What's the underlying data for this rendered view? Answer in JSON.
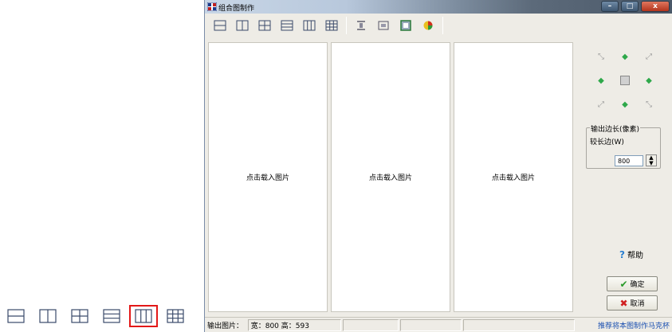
{
  "window": {
    "title": "组合图制作",
    "controls": {
      "minimize": "–",
      "maximize": "□",
      "close": "x"
    }
  },
  "left_toolbar": {
    "buttons": [
      {
        "icon": "layout-2-rows-icon"
      },
      {
        "icon": "layout-2-cols-icon"
      },
      {
        "icon": "layout-2x2-icon"
      },
      {
        "icon": "layout-3-rows-icon"
      },
      {
        "icon": "layout-3-cols-icon",
        "selected": true
      },
      {
        "icon": "layout-3x3-icon"
      }
    ],
    "selected_color": "#e31818"
  },
  "toolbar": {
    "layout_buttons": [
      "layout-2-rows-icon",
      "layout-2-cols-icon",
      "layout-2x2-icon",
      "layout-3-rows-icon",
      "layout-3-cols-icon",
      "layout-3x3-icon"
    ],
    "tool_buttons": [
      "align-icon",
      "fit-icon",
      "frame-icon",
      "color-icon"
    ]
  },
  "panels": [
    {
      "label": "点击载入图片"
    },
    {
      "label": "点击载入图片"
    },
    {
      "label": "点击载入图片"
    }
  ],
  "output": {
    "group_label": "输出边长(像素)",
    "sub_label": "较长边(W)",
    "value": "800"
  },
  "help": {
    "label": "帮助"
  },
  "ok": {
    "label": "确定"
  },
  "cancel": {
    "label": "取消"
  },
  "statusbar": {
    "label": "输出图片：",
    "size": "宽：800 高：593",
    "recommend": "推荐将本图制作马克杯"
  },
  "colors": {
    "accent_green": "#2ea84a",
    "link_blue": "#1a4fb0",
    "cancel_red": "#d02020"
  }
}
